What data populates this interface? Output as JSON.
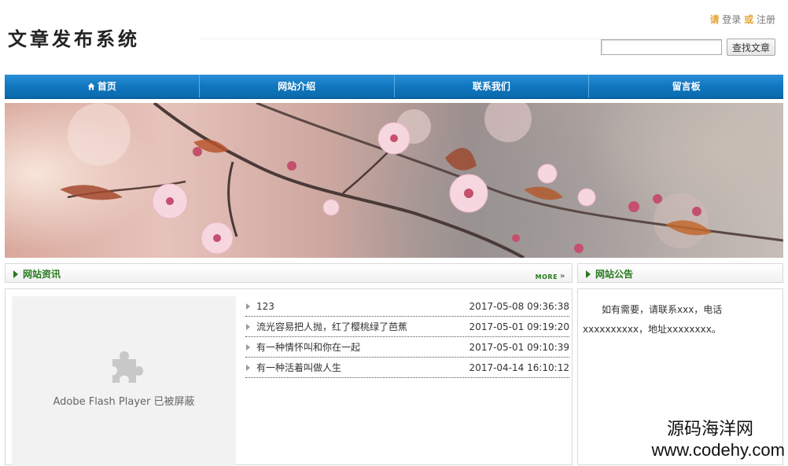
{
  "header": {
    "logo": "文章发布系统",
    "auth_prefix": "请",
    "login": "登录",
    "or": "或",
    "register": "注册",
    "search_placeholder": "",
    "search_button": "查找文章"
  },
  "nav": {
    "items": [
      "首页",
      "网站介绍",
      "联系我们",
      "留言板"
    ]
  },
  "news_section": {
    "title": "网站资讯",
    "more": "MORE",
    "more_arrow": "»",
    "flash_text": "Adobe Flash Player 已被屏蔽",
    "items": [
      {
        "title": "123",
        "time": "2017-05-08 09:36:38"
      },
      {
        "title": "流光容易把人抛，红了樱桃绿了芭蕉",
        "time": "2017-05-01 09:19:20"
      },
      {
        "title": "有一种情怀叫和你在一起",
        "time": "2017-05-01 09:10:39"
      },
      {
        "title": "有一种活着叫做人生",
        "time": "2017-04-14 16:10:12"
      }
    ]
  },
  "notice_section": {
    "title": "网站公告",
    "text": "如有需要，请联系xxx，电话xxxxxxxxxx，地址xxxxxxxx。"
  },
  "watermark": {
    "line1": "源码海洋网",
    "line2": "www.codehy.com"
  },
  "colors": {
    "nav_blue": "#1177bf",
    "section_green": "#277a1e",
    "accent_orange": "#e4a536"
  }
}
